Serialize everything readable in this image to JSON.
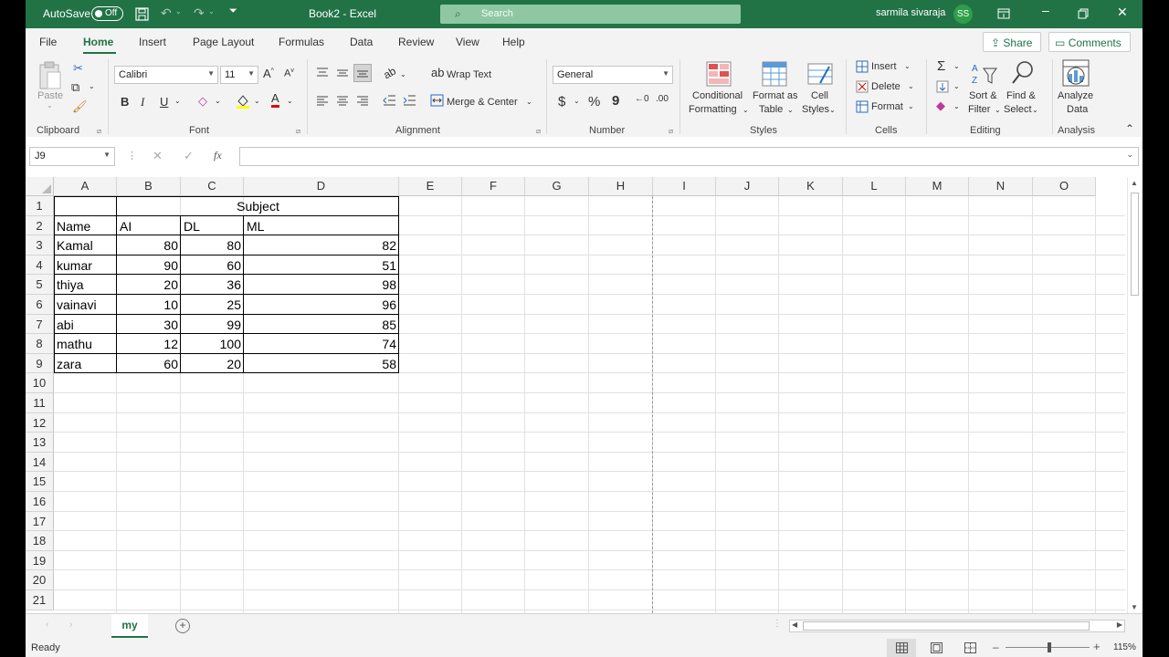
{
  "titlebar": {
    "autosave_label": "AutoSave",
    "autosave_state": "Off",
    "doc_title": "Book2 - Excel",
    "search_placeholder": "Search",
    "user_name": "sarmila sivaraja",
    "user_initials": "SS"
  },
  "menu": {
    "tabs": [
      "File",
      "Home",
      "Insert",
      "Page Layout",
      "Formulas",
      "Data",
      "Review",
      "View",
      "Help"
    ],
    "active_tab": "Home",
    "share_label": "Share",
    "comments_label": "Comments"
  },
  "ribbon": {
    "clipboard": {
      "paste_label": "Paste",
      "group_label": "Clipboard"
    },
    "font": {
      "font_name": "Calibri",
      "font_size": "11",
      "bold": "B",
      "italic": "I",
      "underline": "U",
      "grow": "A",
      "shrink": "A",
      "font_color": "A",
      "group_label": "Font"
    },
    "alignment": {
      "wrap_text": "Wrap Text",
      "merge_center": "Merge & Center",
      "group_label": "Alignment"
    },
    "number": {
      "format": "General",
      "currency": "$",
      "percent": "%",
      "comma": "9",
      "group_label": "Number"
    },
    "styles": {
      "conditional_1": "Conditional",
      "conditional_2": "Formatting",
      "format_table_1": "Format as",
      "format_table_2": "Table",
      "cell_styles_1": "Cell",
      "cell_styles_2": "Styles",
      "group_label": "Styles"
    },
    "cells": {
      "insert": "Insert",
      "delete": "Delete",
      "format": "Format",
      "group_label": "Cells"
    },
    "editing": {
      "sort_1": "Sort &",
      "sort_2": "Filter",
      "find_1": "Find &",
      "find_2": "Select",
      "group_label": "Editing"
    },
    "analysis": {
      "analyze_1": "Analyze",
      "analyze_2": "Data",
      "group_label": "Analysis"
    }
  },
  "formula_bar": {
    "name_box": "J9",
    "fx": "fx",
    "content": ""
  },
  "columns": [
    "A",
    "B",
    "C",
    "D",
    "E",
    "F",
    "G",
    "H",
    "I",
    "J",
    "K",
    "L",
    "M",
    "N",
    "O"
  ],
  "rows": [
    "1",
    "2",
    "3",
    "4",
    "5",
    "6",
    "7",
    "8",
    "9",
    "10",
    "11",
    "12",
    "13",
    "14",
    "15",
    "16",
    "17",
    "18",
    "19",
    "20",
    "21"
  ],
  "sheet": {
    "subject_header": "Subject",
    "headers": [
      "Name",
      "AI",
      "DL",
      "ML"
    ],
    "records": [
      [
        "Kamal",
        "80",
        "80",
        "82"
      ],
      [
        "kumar",
        "90",
        "60",
        "51"
      ],
      [
        "thiya",
        "20",
        "36",
        "98"
      ],
      [
        "vainavi",
        "10",
        "25",
        "96"
      ],
      [
        "abi",
        "30",
        "99",
        "85"
      ],
      [
        "mathu",
        "12",
        "100",
        "74"
      ],
      [
        "zara",
        "60",
        "20",
        "58"
      ]
    ]
  },
  "sheet_tabs": {
    "active": "my",
    "add_icon": "+"
  },
  "status": {
    "ready": "Ready",
    "zoom": "115%"
  },
  "colors": {
    "accent": "#217346",
    "avatar": "#2f9e48"
  }
}
